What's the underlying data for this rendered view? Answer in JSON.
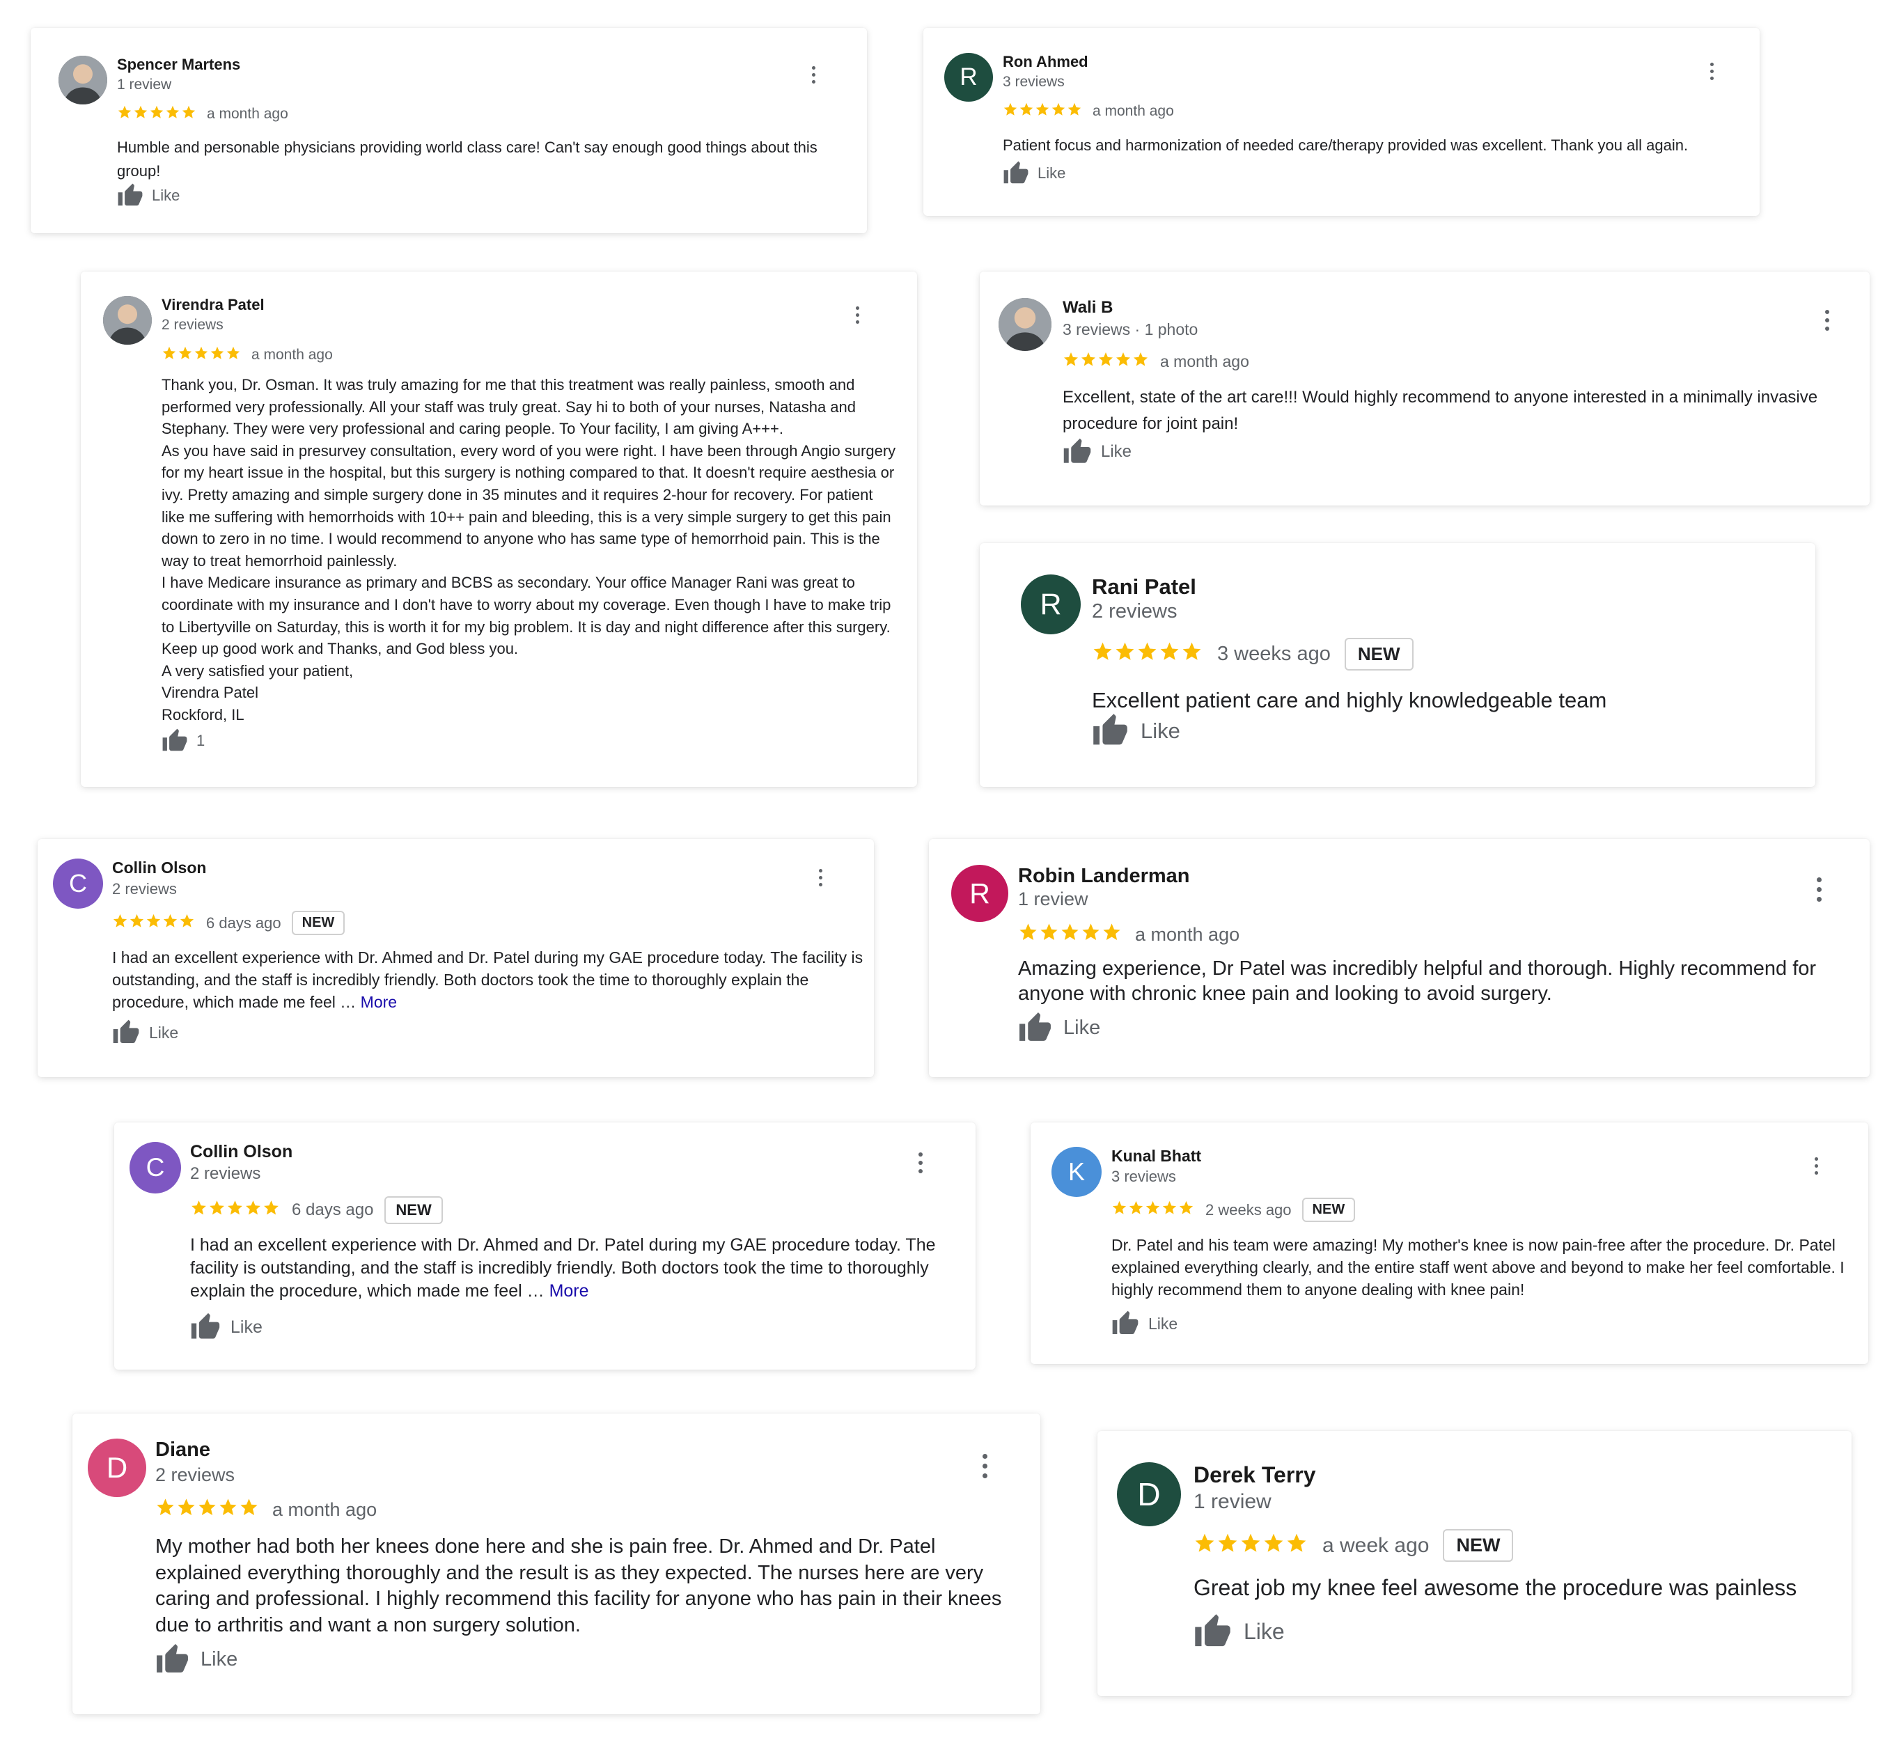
{
  "colors": {
    "star": "#fbbc04",
    "more_link": "#1a0dab",
    "avatar_dark_green": "#1e4d3f",
    "avatar_purple": "#7e57c2",
    "avatar_crimson": "#c2185b",
    "avatar_blue": "#4a90d9",
    "avatar_pink": "#d84a7a"
  },
  "icons": {
    "star": "star-icon",
    "like": "thumbs-up-icon",
    "menu": "more-vert-icon"
  },
  "reviews": [
    {
      "name": "Spencer Martens",
      "meta": "1 review",
      "stars": 5,
      "time": "a month ago",
      "badge": "",
      "text": "Humble and personable physicians providing world class care! Can't say enough good things about this group!",
      "more": "",
      "like": "Like",
      "avatar": {
        "type": "photo",
        "letter": ""
      }
    },
    {
      "name": "Ron Ahmed",
      "meta": "3 reviews",
      "stars": 5,
      "time": "a month ago",
      "badge": "",
      "text": "Patient focus and harmonization of needed care/therapy provided was excellent. Thank you all again.",
      "more": "",
      "like": "Like",
      "avatar": {
        "type": "letter",
        "letter": "R",
        "color": "#1e4d3f"
      }
    },
    {
      "name": "Virendra Patel",
      "meta": "2 reviews",
      "stars": 5,
      "time": "a month ago",
      "badge": "",
      "paragraphs": [
        "Thank you, Dr. Osman. It was truly amazing for me that this treatment was really painless, smooth and performed very professionally. All your staff was truly great. Say hi to both of your nurses, Natasha and Stephany. They were very professional and caring people. To Your facility, I am giving A+++.",
        "As you have said in presurvey consultation, every word of you were right. I have been through Angio surgery for my heart issue in the hospital, but this surgery is nothing compared to that. It doesn't require aesthesia or ivy. Pretty amazing and simple surgery done in 35 minutes and it requires 2-hour for recovery. For patient like me suffering with hemorrhoids with 10++ pain and bleeding, this is a very simple surgery to get this pain down to zero in no time. I would recommend to anyone who has same type of hemorrhoid pain. This is the way to treat hemorrhoid painlessly.",
        "I have Medicare insurance as primary and BCBS as secondary. Your office Manager Rani was great to coordinate with my insurance and I don't have to worry about my coverage. Even though I have to make trip to Libertyville on Saturday, this is worth it for my big problem. It is day and night difference after this surgery. Keep up good work and Thanks, and God bless you.",
        "A very satisfied your patient,",
        "Virendra Patel",
        "Rockford, IL"
      ],
      "like": "1",
      "avatar": {
        "type": "photo",
        "letter": ""
      }
    },
    {
      "name": "Wali B",
      "meta": "3 reviews · 1 photo",
      "stars": 5,
      "time": "a month ago",
      "badge": "",
      "text": "Excellent, state of the art care!!! Would highly recommend to anyone interested in a minimally invasive procedure for joint pain!",
      "more": "",
      "like": "Like",
      "avatar": {
        "type": "photo",
        "letter": ""
      }
    },
    {
      "name": "Rani Patel",
      "meta": "2 reviews",
      "stars": 5,
      "time": "3 weeks ago",
      "badge": "NEW",
      "text": "Excellent patient care and highly knowledgeable team",
      "more": "",
      "like": "Like",
      "avatar": {
        "type": "letter",
        "letter": "R",
        "color": "#1e4d3f"
      }
    },
    {
      "name": "Collin Olson",
      "meta": "2 reviews",
      "stars": 5,
      "time": "6 days ago",
      "badge": "NEW",
      "text": "I had an excellent experience with Dr. Ahmed and Dr. Patel during my GAE procedure today. The facility is outstanding, and the staff is incredibly friendly. Both doctors took the time to thoroughly explain the procedure, which made me feel …",
      "more": "More",
      "like": "Like",
      "avatar": {
        "type": "letter",
        "letter": "C",
        "color": "#7e57c2"
      }
    },
    {
      "name": "Robin Landerman",
      "meta": "1 review",
      "stars": 5,
      "time": "a month ago",
      "badge": "",
      "text": "Amazing experience, Dr Patel was incredibly helpful and thorough. Highly recommend for anyone with chronic knee pain and looking to avoid surgery.",
      "more": "",
      "like": "Like",
      "avatar": {
        "type": "letter",
        "letter": "R",
        "color": "#c2185b"
      }
    },
    {
      "name": "Collin Olson",
      "meta": "2 reviews",
      "stars": 5,
      "time": "6 days ago",
      "badge": "NEW",
      "text": "I had an excellent experience with Dr. Ahmed and Dr. Patel during my GAE procedure today. The facility is outstanding, and the staff is incredibly friendly. Both doctors took the time to thoroughly explain the procedure, which made me feel …",
      "more": "More",
      "like": "Like",
      "avatar": {
        "type": "letter",
        "letter": "C",
        "color": "#7e57c2"
      }
    },
    {
      "name": "Kunal Bhatt",
      "meta": "3 reviews",
      "stars": 5,
      "time": "2 weeks ago",
      "badge": "NEW",
      "text": "Dr. Patel and his team were amazing! My mother's knee is now pain-free after the procedure. Dr. Patel explained everything clearly, and the entire staff went above and beyond to make her feel comfortable. I highly recommend them to anyone dealing with knee pain!",
      "more": "",
      "like": "Like",
      "avatar": {
        "type": "letter",
        "letter": "K",
        "color": "#4a90d9"
      }
    },
    {
      "name": "Diane",
      "meta": "2 reviews",
      "stars": 5,
      "time": "a month ago",
      "badge": "",
      "text": "My mother had both her knees done here and she is pain free. Dr. Ahmed and Dr. Patel explained everything thoroughly and the result is as they expected. The nurses here are very caring and professional. I highly recommend this facility for anyone who has pain in their knees due to arthritis and want a non surgery solution.",
      "more": "",
      "like": "Like",
      "avatar": {
        "type": "letter",
        "letter": "D",
        "color": "#d84a7a"
      }
    },
    {
      "name": "Derek Terry",
      "meta": "1 review",
      "stars": 5,
      "time": "a week ago",
      "badge": "NEW",
      "text": "Great job my knee feel awesome the procedure was painless",
      "more": "",
      "like": "Like",
      "avatar": {
        "type": "letter",
        "letter": "D",
        "color": "#1e4d3f"
      }
    }
  ]
}
